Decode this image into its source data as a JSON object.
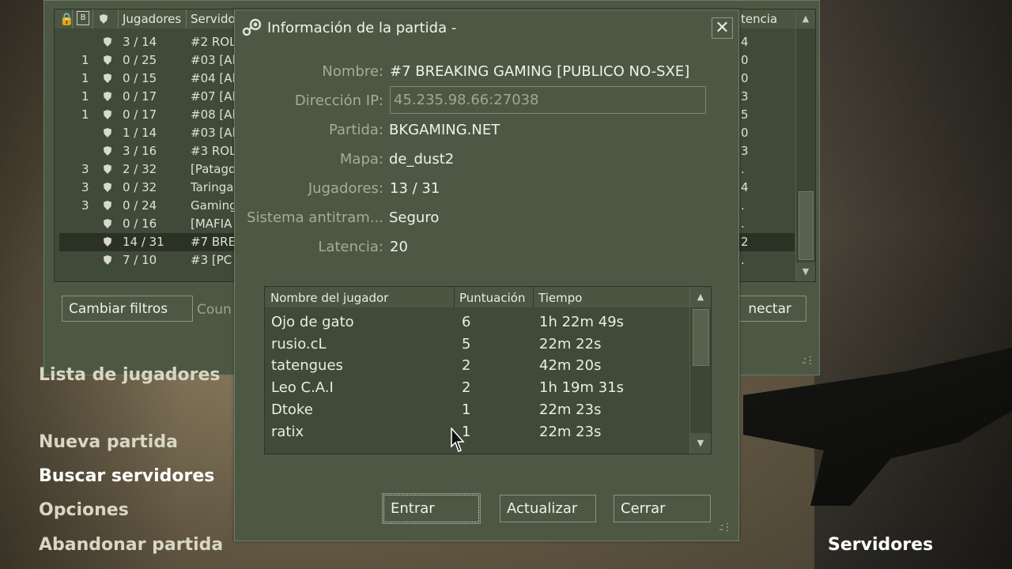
{
  "browser": {
    "columns": [
      "Jugadores",
      "Servidor",
      "tencia"
    ],
    "rows": [
      {
        "bots": "",
        "players": "3 / 14",
        "server": "#2 ROL",
        "lat": "4"
      },
      {
        "bots": "1",
        "players": "0 / 25",
        "server": "#03 [Al",
        "lat": "0"
      },
      {
        "bots": "1",
        "players": "0 / 15",
        "server": "#04 [Al",
        "lat": "0"
      },
      {
        "bots": "1",
        "players": "0 / 17",
        "server": "#07 [Al",
        "lat": "3"
      },
      {
        "bots": "1",
        "players": "0 / 17",
        "server": "#08 [Al",
        "lat": "5"
      },
      {
        "bots": "",
        "players": "1 / 14",
        "server": "#03 [Al",
        "lat": "0"
      },
      {
        "bots": "",
        "players": "3 / 16",
        "server": "#3 ROL",
        "lat": "3"
      },
      {
        "bots": "3",
        "players": "2 / 32",
        "server": "[Patago",
        "lat": "."
      },
      {
        "bots": "3",
        "players": "0 / 32",
        "server": "Taringa",
        "lat": "4"
      },
      {
        "bots": "3",
        "players": "0 / 24",
        "server": "Gaming",
        "lat": "."
      },
      {
        "bots": "",
        "players": "0 / 16",
        "server": "[MAFIA",
        "lat": "."
      },
      {
        "bots": "",
        "players": "14 / 31",
        "server": "#7 BRE",
        "lat": "2"
      },
      {
        "bots": "",
        "players": "7 / 10",
        "server": "#3 [PC",
        "lat": "."
      }
    ],
    "filter_button": "Cambiar filtros",
    "country_text": "Coun",
    "connect_button": "nectar"
  },
  "menu": {
    "items": [
      "Lista de jugadores",
      "Nueva partida",
      "Buscar servidores",
      "Opciones",
      "Abandonar partida"
    ],
    "servers_label": "Servidores"
  },
  "dialog": {
    "title": "Información de la partida -",
    "fields": {
      "name_label": "Nombre:",
      "name_value": "#7 BREAKING GAMING [PUBLICO NO-SXE]",
      "ip_label": "Dirección IP:",
      "ip_value": "45.235.98.66:27038",
      "game_label": "Partida:",
      "game_value": "BKGAMING.NET",
      "map_label": "Mapa:",
      "map_value": "de_dust2",
      "players_label": "Jugadores:",
      "players_value": "13 / 31",
      "anticheat_label": "Sistema antitram...",
      "anticheat_value": "Seguro",
      "latency_label": "Latencia:",
      "latency_value": "20"
    },
    "player_list": {
      "columns": [
        "Nombre del jugador",
        "Puntuación",
        "Tiempo"
      ],
      "rows": [
        {
          "name": "Ojo de gato",
          "score": "6",
          "time": "1h 22m 49s"
        },
        {
          "name": "rusio.cL",
          "score": "5",
          "time": "22m 22s"
        },
        {
          "name": "tatengues",
          "score": "2",
          "time": "42m 20s"
        },
        {
          "name": "Leo C.A.I",
          "score": "2",
          "time": "1h 19m 31s"
        },
        {
          "name": "Dtoke",
          "score": "1",
          "time": "22m 23s"
        },
        {
          "name": "ratix",
          "score": "1",
          "time": "22m 23s"
        }
      ]
    },
    "buttons": {
      "join": "Entrar",
      "refresh": "Actualizar",
      "close": "Cerrar"
    }
  }
}
